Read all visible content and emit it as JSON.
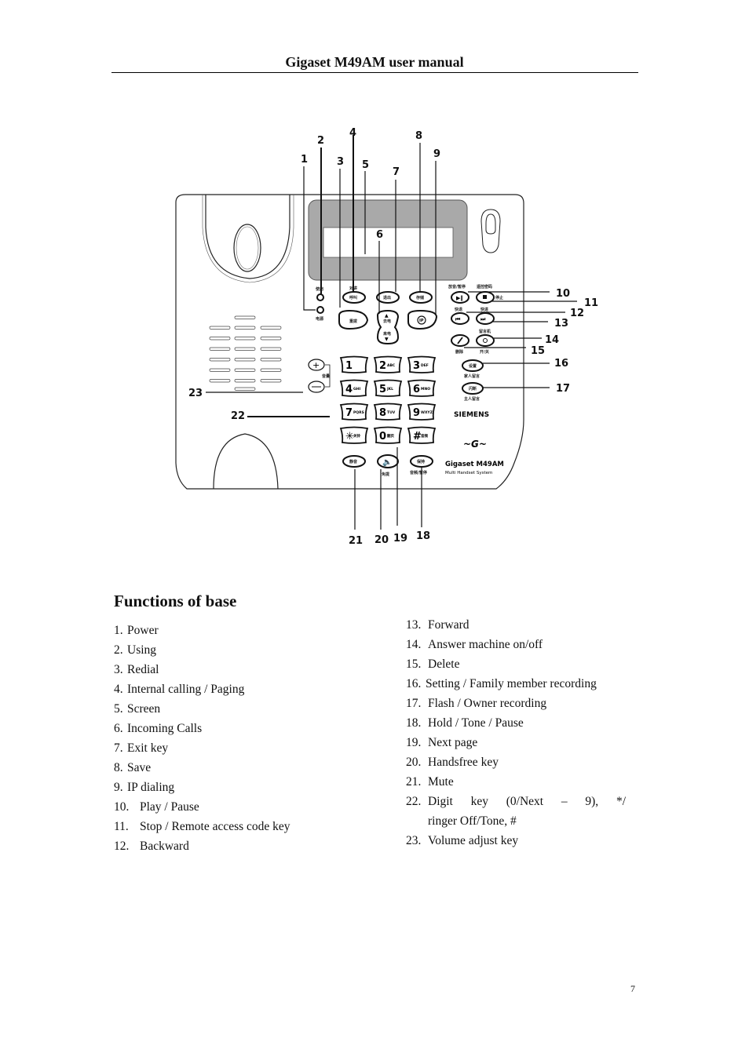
{
  "header": {
    "title": "Gigaset M49AM user manual"
  },
  "diagram": {
    "callouts": [
      "1",
      "2",
      "3",
      "4",
      "5",
      "6",
      "7",
      "8",
      "9",
      "10",
      "11",
      "12",
      "13",
      "14",
      "15",
      "16",
      "17",
      "18",
      "19",
      "20",
      "21",
      "22",
      "23"
    ],
    "brand": "SIEMENS",
    "model": "Gigaset M49AM",
    "model_subtitle": "Multi Handset System",
    "keypad": [
      {
        "digit": "1",
        "letters": ""
      },
      {
        "digit": "2",
        "letters": "ABC"
      },
      {
        "digit": "3",
        "letters": "DEF"
      },
      {
        "digit": "4",
        "letters": "GHI"
      },
      {
        "digit": "5",
        "letters": "JKL"
      },
      {
        "digit": "6",
        "letters": "MNO"
      },
      {
        "digit": "7",
        "letters": "PQRS"
      },
      {
        "digit": "8",
        "letters": "TUV"
      },
      {
        "digit": "9",
        "letters": "WXYZ"
      },
      {
        "digit": "✳",
        "letters": "关铃"
      },
      {
        "digit": "0",
        "letters": "翻页"
      },
      {
        "digit": "#",
        "letters": "音频"
      }
    ],
    "button_labels": {
      "using": "使用",
      "power": "电源",
      "intercom_top": "对讲",
      "intercom": "呼叫",
      "redial": "重拨",
      "exit": "退出",
      "save": "存储",
      "ip": "IP",
      "outgoing": "去电",
      "incoming": "来电",
      "play_pause_top": "放音/暂停",
      "stop_top": "遥控密码",
      "stop_side": "停止",
      "backward_top": "快退",
      "forward_top": "快进",
      "answer_top": "留言机",
      "delete_bottom": "删除",
      "onoff_bottom": "开/关",
      "setting": "设置",
      "setting_bottom": "家人留言",
      "flash": "闪断",
      "flash_bottom": "主人留言",
      "volume": "音量",
      "mute": "静音",
      "handsfree_bottom": "免提",
      "hold": "保持",
      "hold_bottom": "音频/暂停"
    }
  },
  "section": {
    "title": "Functions of base"
  },
  "functions_left": [
    {
      "num": "1.",
      "text": "Power"
    },
    {
      "num": "2.",
      "text": "Using"
    },
    {
      "num": "3.",
      "text": "Redial"
    },
    {
      "num": "4.",
      "text": "Internal calling / Paging"
    },
    {
      "num": "5.",
      "text": "Screen"
    },
    {
      "num": "6.",
      "text": "Incoming Calls"
    },
    {
      "num": "7.",
      "text": "Exit key"
    },
    {
      "num": "8.",
      "text": "Save"
    },
    {
      "num": "9.",
      "text": "IP dialing"
    },
    {
      "num": "10.",
      "text": "Play / Pause"
    },
    {
      "num": "11.",
      "text": "Stop / Remote access code key"
    },
    {
      "num": "12.",
      "text": "Backward"
    }
  ],
  "functions_right": [
    {
      "num": "13.",
      "text": "Forward"
    },
    {
      "num": "14.",
      "text": "Answer machine on/off"
    },
    {
      "num": "15.",
      "text": "Delete"
    },
    {
      "num": "16.",
      "text": "Setting / Family member recording"
    },
    {
      "num": "17.",
      "text": "Flash / Owner recording"
    },
    {
      "num": "18.",
      "text": "Hold / Tone / Pause"
    },
    {
      "num": "19.",
      "text": "Next page"
    },
    {
      "num": "20.",
      "text": "Handsfree key"
    },
    {
      "num": "21.",
      "text": "Mute"
    },
    {
      "num": "22.",
      "text": "Digit key (0/Next – 9), */",
      "continuation": "ringer Off/Tone, #"
    },
    {
      "num": "23.",
      "text": "Volume adjust key"
    }
  ],
  "footer": {
    "page_number": "7"
  }
}
